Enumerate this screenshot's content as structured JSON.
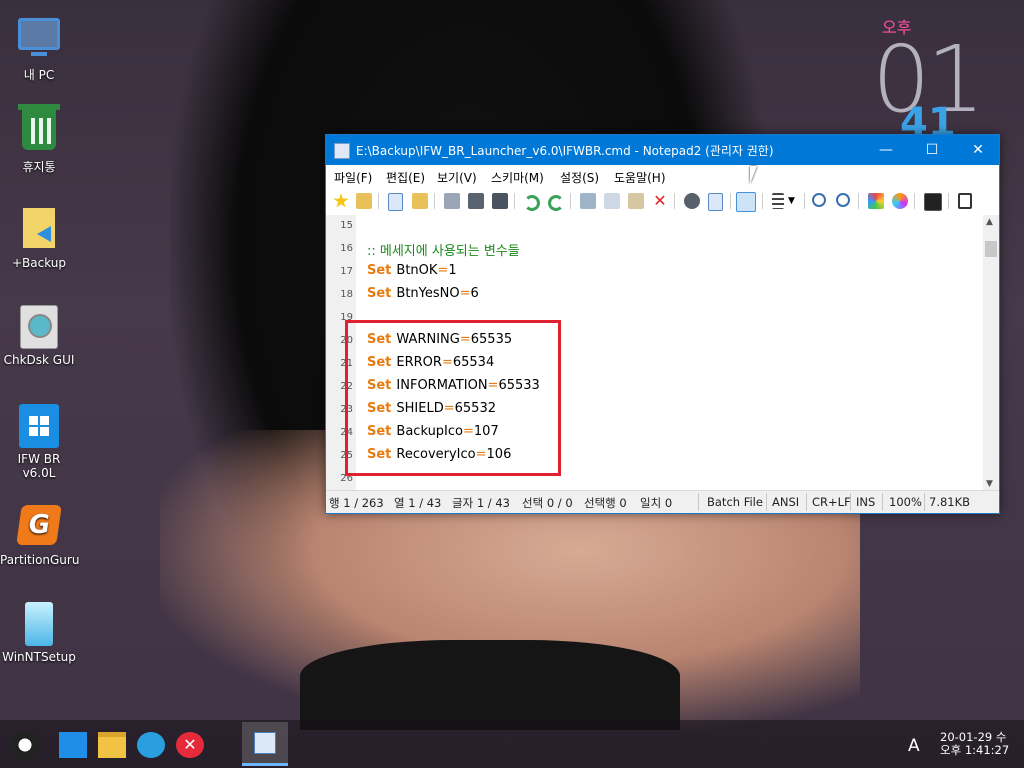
{
  "desktop_icons": [
    {
      "label": "내 PC",
      "icon": "pc-icon"
    },
    {
      "label": "휴지통",
      "icon": "recycle-bin-icon"
    },
    {
      "label": "+Backup",
      "icon": "folder-shortcut-icon"
    },
    {
      "label": "ChkDsk GUI",
      "icon": "disk-check-icon"
    },
    {
      "label": "IFW BR v6.0L",
      "icon": "windows-logo-icon"
    },
    {
      "label": "PartitionGuru",
      "icon": "partitionguru-icon"
    },
    {
      "label": "WinNTSetup",
      "icon": "winntsetup-icon"
    }
  ],
  "clock_widget": {
    "ampm": "오후",
    "hour": "01",
    "minute": "41"
  },
  "window": {
    "title": "E:\\Backup\\IFW_BR_Launcher_v6.0\\IFWBR.cmd - Notepad2 (관리자 권한)",
    "buttons": {
      "minimize": "—",
      "maximize": "☐",
      "close": "✕"
    },
    "menu": [
      "파일(F)",
      "편집(E)",
      "보기(V)",
      "스키마(M)",
      "설정(S)",
      "도움말(H)"
    ],
    "lines": [
      {
        "n": "15",
        "kw": "",
        "rest": "",
        "op": "",
        "val": "",
        "comment": ""
      },
      {
        "n": "16",
        "kw": "",
        "rest": "",
        "op": "",
        "val": "",
        "comment": ":: 메세지에 사용되는 변수들"
      },
      {
        "n": "17",
        "kw": "Set",
        "rest": "BtnOK",
        "op": "=",
        "val": "1",
        "comment": ""
      },
      {
        "n": "18",
        "kw": "Set",
        "rest": "BtnYesNO",
        "op": "=",
        "val": "6",
        "comment": ""
      },
      {
        "n": "19",
        "kw": "",
        "rest": "",
        "op": "",
        "val": "",
        "comment": ""
      },
      {
        "n": "20",
        "kw": "Set",
        "rest": "WARNING",
        "op": "=",
        "val": "65535",
        "comment": ""
      },
      {
        "n": "21",
        "kw": "Set",
        "rest": "ERROR",
        "op": "=",
        "val": "65534",
        "comment": ""
      },
      {
        "n": "22",
        "kw": "Set",
        "rest": "INFORMATION",
        "op": "=",
        "val": "65533",
        "comment": ""
      },
      {
        "n": "23",
        "kw": "Set",
        "rest": "SHIELD",
        "op": "=",
        "val": "65532",
        "comment": ""
      },
      {
        "n": "24",
        "kw": "Set",
        "rest": "BackupIco",
        "op": "=",
        "val": "107",
        "comment": ""
      },
      {
        "n": "25",
        "kw": "Set",
        "rest": "RecoveryIco",
        "op": "=",
        "val": "106",
        "comment": ""
      },
      {
        "n": "26",
        "kw": "",
        "rest": "",
        "op": "",
        "val": "",
        "comment": ""
      }
    ],
    "status": {
      "line": "행 1 / 263",
      "col": "열 1 / 43",
      "char": "글자 1 / 43",
      "sel": "선택 0 / 0",
      "selrows": "선택행 0",
      "match": "일치 0",
      "scheme": "Batch File",
      "encoding": "ANSI",
      "eol": "CR+LF",
      "mode": "INS",
      "zoom": "100%",
      "size": "7.81KB"
    }
  },
  "taskbar": {
    "ime": "A",
    "date": "20-01-29 수",
    "time": "오후 1:41:27"
  },
  "colors": {
    "accent": "#0078d7",
    "keyword": "#e87b0f",
    "comment": "#1a8a1a",
    "highlight_box": "#e02030"
  }
}
